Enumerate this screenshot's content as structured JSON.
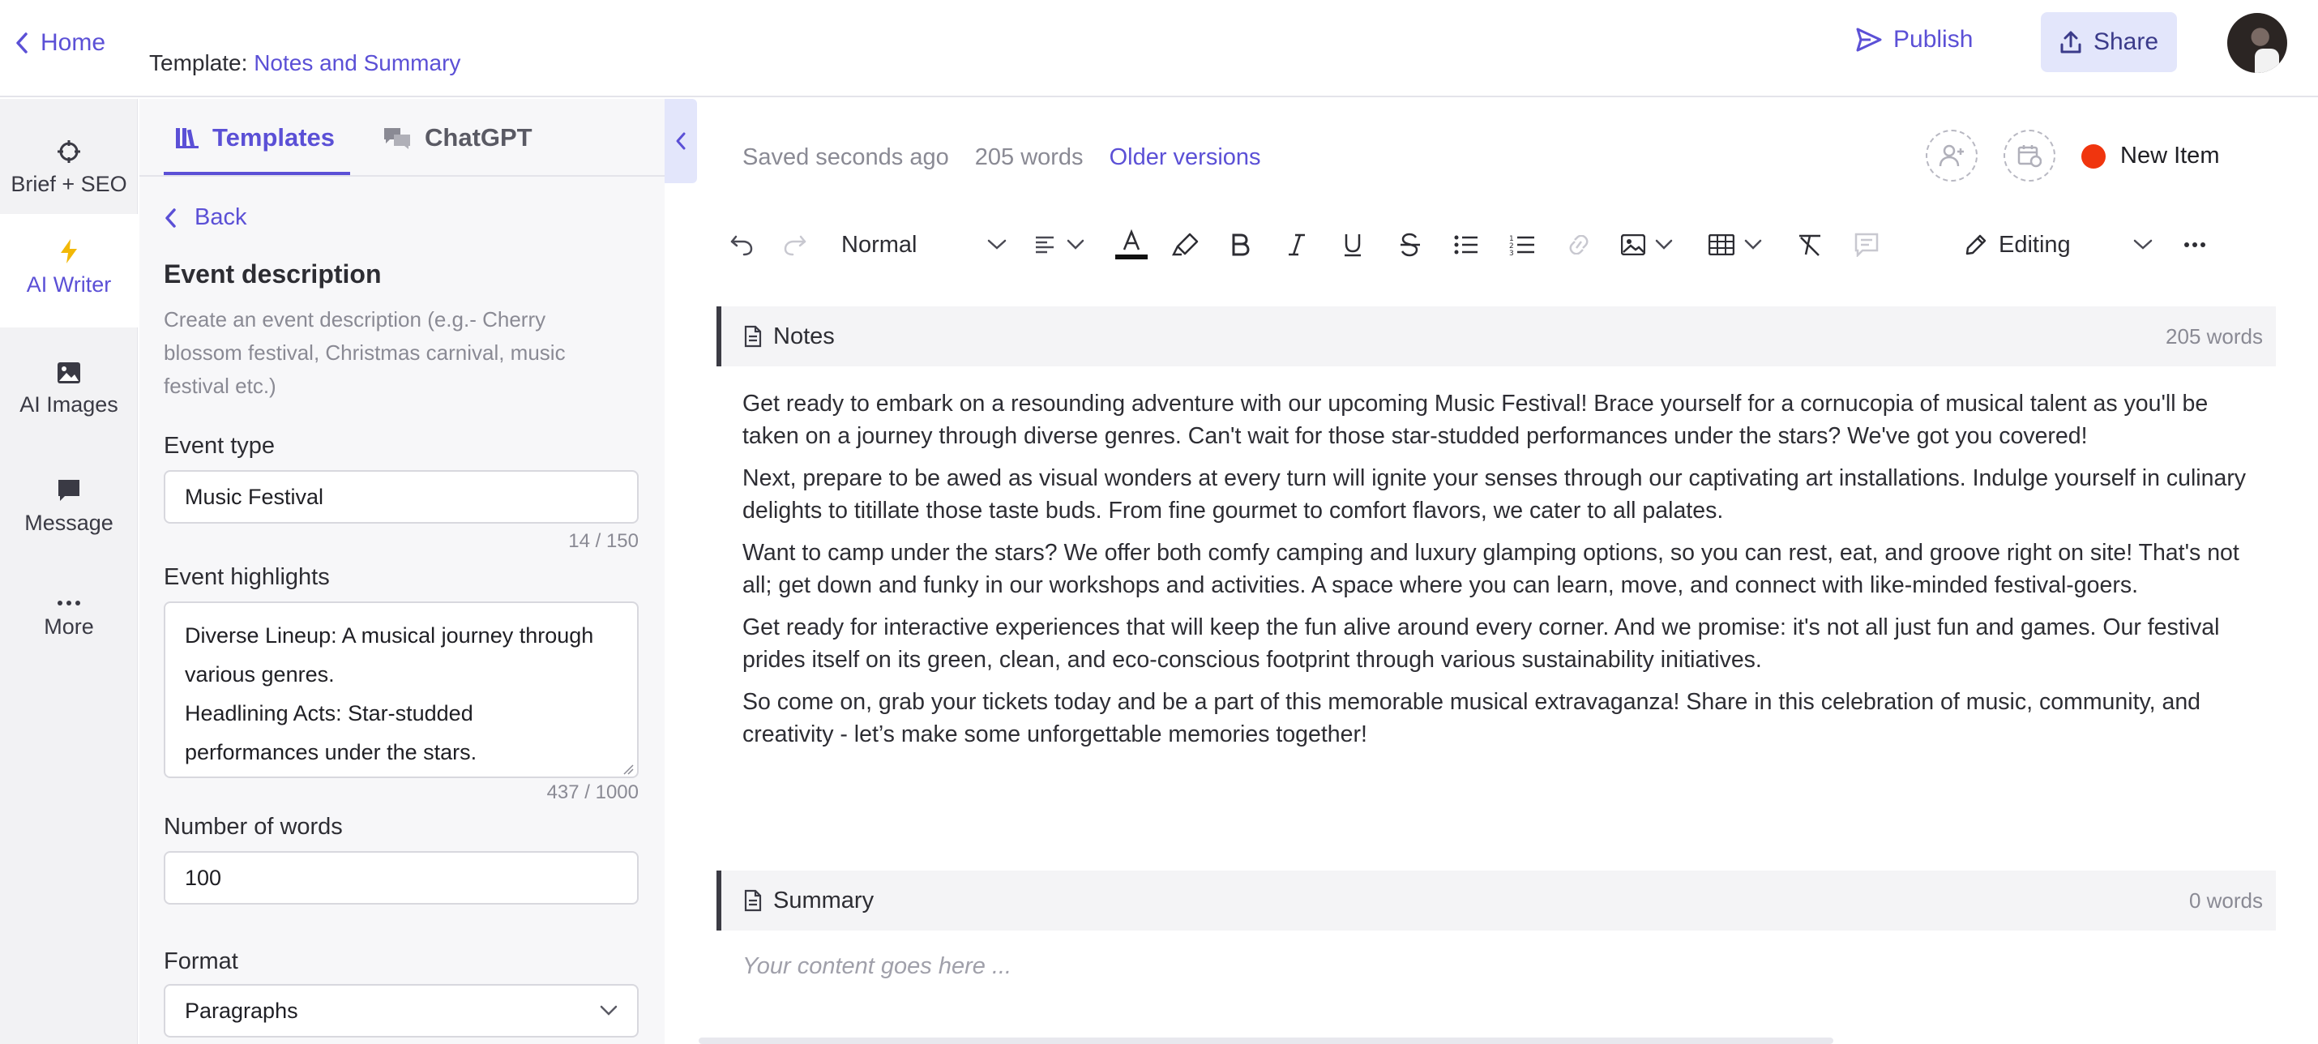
{
  "header": {
    "home_label": "Home",
    "template_prefix": "Template:",
    "template_name": "Notes and Summary",
    "publish_label": "Publish",
    "share_label": "Share"
  },
  "rail": {
    "items": [
      {
        "label": "Brief + SEO",
        "icon": "crosshair-icon"
      },
      {
        "label": "AI Writer",
        "icon": "bolt-icon",
        "active": true
      },
      {
        "label": "AI Images",
        "icon": "image-icon"
      },
      {
        "label": "Message",
        "icon": "message-icon"
      },
      {
        "label": "More",
        "icon": "more-dots-icon"
      }
    ]
  },
  "panel": {
    "tabs": [
      {
        "label": "Templates",
        "icon": "templates-icon",
        "active": true
      },
      {
        "label": "ChatGPT",
        "icon": "chat-icon"
      }
    ],
    "back_label": "Back",
    "title": "Event description",
    "description": "Create an event description (e.g.- Cherry blossom festival, Christmas carnival, music festival etc.)",
    "fields": {
      "event_type": {
        "label": "Event type",
        "value": "Music Festival",
        "counter": "14 / 150"
      },
      "event_highlights": {
        "label": "Event highlights",
        "value_line1": "Diverse Lineup: A musical journey through",
        "value_line2": "various genres.",
        "value_line3": "Headlining Acts: Star-studded",
        "value_line4": "performances under the stars.",
        "counter": "437 / 1000"
      },
      "number_of_words": {
        "label": "Number of words",
        "value": "100"
      },
      "format": {
        "label": "Format",
        "value": "Paragraphs"
      }
    }
  },
  "main": {
    "saved_text": "Saved seconds ago",
    "word_count": "205 words",
    "older_versions": "Older versions",
    "status_label": "New Item",
    "status_color": "#f0350e",
    "toolbar": {
      "block_style": "Normal",
      "mode": "Editing"
    },
    "notes": {
      "title": "Notes",
      "count": "205 words",
      "paragraphs": [
        "Get ready to embark on a resounding adventure with our upcoming Music Festival! Brace yourself for a cornucopia of musical talent as you'll be taken on a journey through diverse genres. Can't wait for those star-studded performances under the stars? We've got you covered!",
        "Next, prepare to be awed as visual wonders at every turn will ignite your senses through our captivating art installations. Indulge yourself in culinary delights to titillate those taste buds. From fine gourmet to comfort flavors, we cater to all palates.",
        "Want to camp under the stars? We offer both comfy camping and luxury glamping options, so you can rest, eat, and groove right on site! That's not all; get down and funky in our workshops and activities. A space where you can learn, move, and connect with like-minded festival-goers.",
        "Get ready for interactive experiences that will keep the fun alive around every corner. And we promise: it's not all just fun and games. Our festival prides itself on its green, clean, and eco-conscious footprint through various sustainability initiatives.",
        "So come on, grab your tickets today and be a part of this memorable musical extravaganza! Share in this celebration of music, community, and creativity - let’s make some unforgettable memories together!"
      ]
    },
    "summary": {
      "title": "Summary",
      "count": "0 words",
      "placeholder": "Your content goes here ..."
    }
  },
  "colors": {
    "accent": "#5b50d6",
    "share_bg": "#e3e6fb"
  }
}
